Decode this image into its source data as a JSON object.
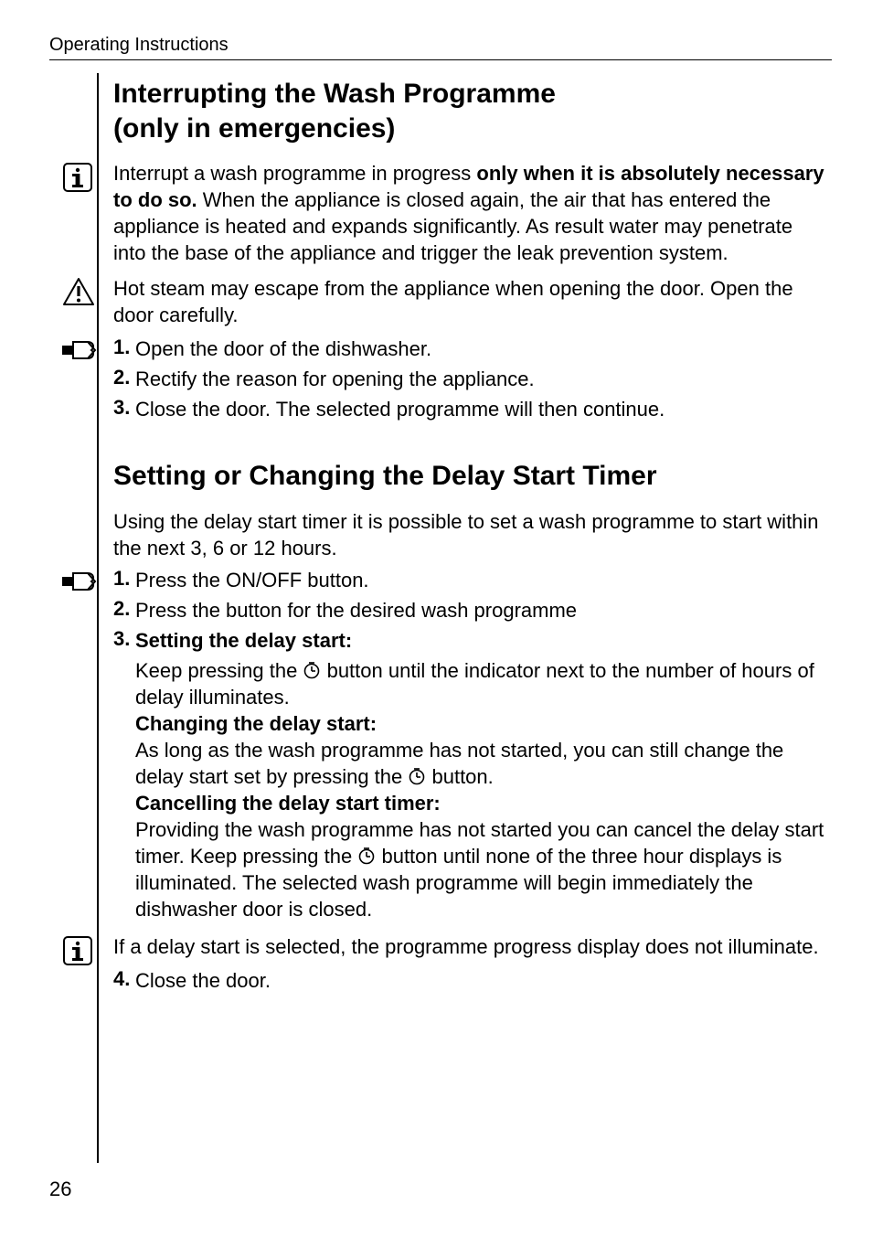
{
  "header": {
    "running": "Operating Instructions"
  },
  "section1": {
    "title_l1": "Interrupting the Wash Programme",
    "title_l2": "(only in emergencies)",
    "info_p1_a": "Interrupt a wash programme in progress ",
    "info_p1_b": "only when it is absolutely necessary to do so. ",
    "info_p1_c": "When the appliance is closed again, the air that has entered the appliance is heated and expands significantly. As result water may penetrate into the base of the appliance and trigger the leak prevention system.",
    "warn_p": "Hot steam may escape from the appliance when opening the door. Open the door carefully.",
    "step1_num": "1.",
    "step1_txt": "Open the door of the dishwasher.",
    "step2_num": "2.",
    "step2_txt": "Rectify the reason for opening the appliance.",
    "step3_num": "3.",
    "step3_txt": "Close the door. The selected programme will then continue."
  },
  "section2": {
    "title": "Setting or Changing the Delay Start Timer",
    "intro": "Using the delay start timer it is possible to set a wash programme to start within the next 3, 6 or 12 hours.",
    "s1_num": "1.",
    "s1_txt": "Press the ON/OFF button.",
    "s2_num": "2.",
    "s2_txt": "Press the button for the desired wash programme",
    "s3_num": "3.",
    "s3_head": "Setting the delay start:",
    "s3_body_a": "Keep pressing the ",
    "s3_body_b": " button until the indicator next to the number of hours of delay illuminates.",
    "s3_head2": "Changing the delay start:",
    "s3_body2_a": "As long as the wash programme has not started, you can still change the delay start set by pressing the ",
    "s3_body2_b": " button.",
    "s3_head3": "Cancelling the delay start timer:",
    "s3_body3_a": "Providing the wash programme has not started you can cancel the delay start timer. Keep pressing the ",
    "s3_body3_b": " button until none of the three hour displays is illuminated. The selected wash programme will begin immediately the dishwasher door is closed.",
    "info2": "If a delay start is selected, the programme progress display does not illuminate.",
    "s4_num": "4.",
    "s4_txt": "Close the door."
  },
  "footer": {
    "page": "26"
  }
}
